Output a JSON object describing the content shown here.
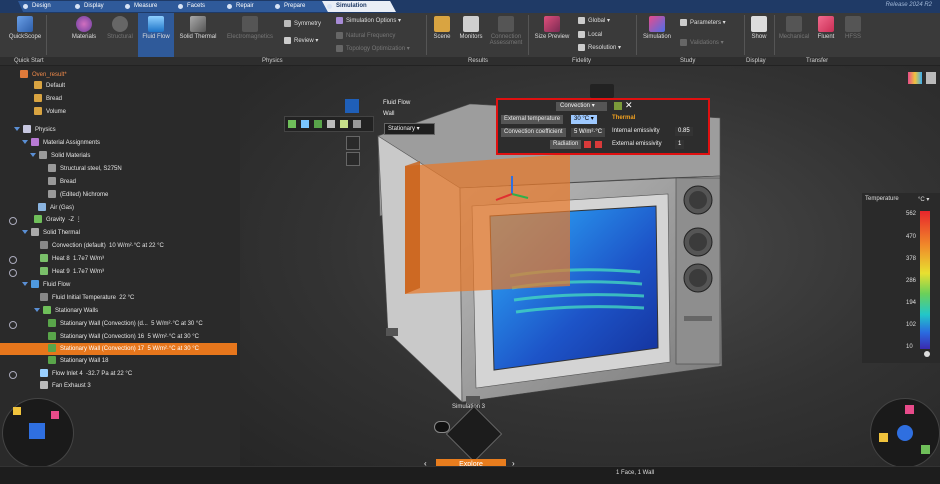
{
  "tabs": [
    "Design",
    "Display",
    "Measure",
    "Facets",
    "Repair",
    "Prepare",
    "Simulation"
  ],
  "release": "Release 2024 R2",
  "ribbon": {
    "quickscope": "QuickScope",
    "materials": "Materials",
    "structural": "Structural",
    "fluid_flow": "Fluid Flow",
    "solid_thermal": "Solid Thermal",
    "electromagnetics": "Electromagnetics",
    "symmetry": "Symmetry",
    "review": "Review",
    "simulation_options": "Simulation Options",
    "natural_frequency": "Natural Frequency",
    "topology_optimization": "Topology Optimization",
    "scene": "Scene",
    "monitors": "Monitors",
    "connection_assessment": "Connection Assessment",
    "size_preview": "Size Preview",
    "global": "Global",
    "local": "Local",
    "resolution": "Resolution",
    "simulation": "Simulation",
    "parameters": "Parameters",
    "validations": "Validations",
    "show": "Show",
    "mechanical": "Mechanical",
    "fluent": "Fluent",
    "hfss": "HFSS",
    "groups": [
      "Quick Start",
      "Physics",
      "Results",
      "Fidelity",
      "Study",
      "Display",
      "Transfer"
    ]
  },
  "tree": {
    "file": "Oven_result*",
    "items": [
      "Default",
      "Bread",
      "Volume"
    ],
    "physics": "Physics",
    "material_assignments": "Material Assignments",
    "solid_materials": "Solid Materials",
    "steel": "Structural steel, S275N",
    "bread": "Bread",
    "nichrome": "(Edited) Nichrome",
    "air": "Air (Gas)",
    "gravity": "Gravity",
    "gravity_val": "-Z",
    "solid_thermal": "Solid Thermal",
    "convection": "Convection (default)",
    "convection_val": "10 W/m²·°C",
    "at": "at",
    "convection_temp": "22 °C",
    "heat8": "Heat 8",
    "heat8_val": "1.7e7 W/m³",
    "heat9": "Heat 9",
    "heat9_val": "1.7e7 W/m³",
    "fluid_flow": "Fluid Flow",
    "fluid_init": "Fluid Initial Temperature",
    "fluid_init_val": "22 °C",
    "stationary_walls": "Stationary Walls",
    "wall1": "Stationary Wall (Convection) (d...",
    "wall1_val": "5 W/m²·°C",
    "wall1_temp": "30 °C",
    "wall16": "Stationary Wall (Convection) 16",
    "wall16_val": "5 W/m²·°C",
    "wall16_temp": "30 °C",
    "wall17": "Stationary Wall (Convection) 17",
    "wall17_val": "5 W/m²·°C",
    "wall17_temp": "30 °C",
    "wall18": "Stationary Wall 18",
    "flow_inlet": "Flow Inlet 4",
    "flow_inlet_val": "-32.7 Pa",
    "flow_inlet_temp": "22 °C",
    "fan": "Fan Exhaust 3"
  },
  "viewport": {
    "fluid_flow_label": "Fluid Flow",
    "wall_label": "Wall",
    "stationary": "Stationary",
    "simulation_label": "Simulation 3",
    "explore": "Explore"
  },
  "popup": {
    "convection": "Convection",
    "external_temperature": "External temperature",
    "ext_temp_val": "30 °C",
    "convection_coefficient": "Convection coefficient",
    "conv_coef_val": "5 W/m²·°C",
    "radiation": "Radiation",
    "thermal": "Thermal",
    "internal_emissivity": "Internal emissivity",
    "int_em_val": "0.85",
    "external_emissivity": "External emissivity",
    "ext_em_val": "1"
  },
  "legend": {
    "title": "Temperature",
    "unit": "°C",
    "ticks": [
      "562",
      "470",
      "378",
      "286",
      "194",
      "102",
      "10"
    ]
  },
  "status": "1 Face, 1 Wall"
}
